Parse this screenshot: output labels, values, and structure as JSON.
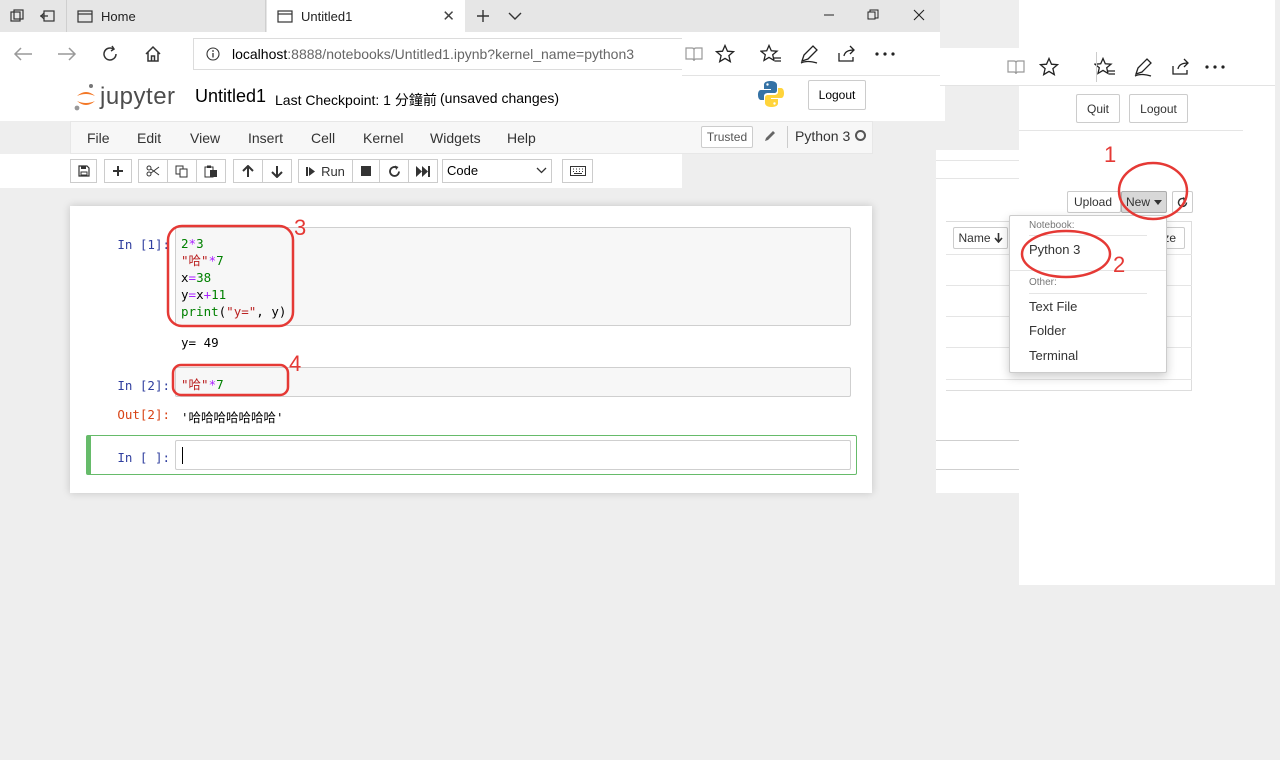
{
  "browser": {
    "tabs": [
      {
        "label": "Home"
      },
      {
        "label": "Untitled1"
      }
    ],
    "address": {
      "host": "localhost",
      "path": ":8888/notebooks/Untitled1.ipynb?kernel_name=python3"
    }
  },
  "jupyter": {
    "logo_text": "jupyter",
    "notebook_name": "Untitled1",
    "checkpoint": "Last Checkpoint: 1 分鐘前",
    "unsaved": "(unsaved changes)",
    "logout_label": "Logout",
    "menu": [
      "File",
      "Edit",
      "View",
      "Insert",
      "Cell",
      "Kernel",
      "Widgets",
      "Help"
    ],
    "trusted_label": "Trusted",
    "kernel_name": "Python 3",
    "toolbar": {
      "run_label": "Run",
      "cell_type": "Code"
    }
  },
  "cells": [
    {
      "prompt": "In [1]:",
      "lines": [
        "2*3",
        "\"哈\"*7",
        "x=38",
        "y=x+11",
        "print(\"y=\", y)"
      ],
      "output": "y= 49"
    },
    {
      "prompt": "In [2]:",
      "lines": [
        "\"哈\"*7"
      ],
      "out_prompt": "Out[2]:",
      "output": "'哈哈哈哈哈哈哈'"
    },
    {
      "prompt": "In [ ]:"
    }
  ],
  "file_browser": {
    "quit_label": "Quit",
    "logout_label": "Logout",
    "upload_label": "Upload",
    "new_label": "New",
    "name_header": "Name",
    "size_header_fragment": "ze",
    "dropdown": {
      "notebook_header": "Notebook:",
      "python3": "Python 3",
      "other_header": "Other:",
      "text_file": "Text File",
      "folder": "Folder",
      "terminal": "Terminal"
    }
  },
  "annotations": {
    "n1": "1",
    "n2": "2",
    "n3": "3",
    "n4": "4",
    "color": "#e53935"
  },
  "colors": {
    "jupyter_orange": "#f37726",
    "prompt_in": "#303f9f",
    "prompt_out": "#d84315",
    "selected_cell_border": "#66bb6a"
  }
}
